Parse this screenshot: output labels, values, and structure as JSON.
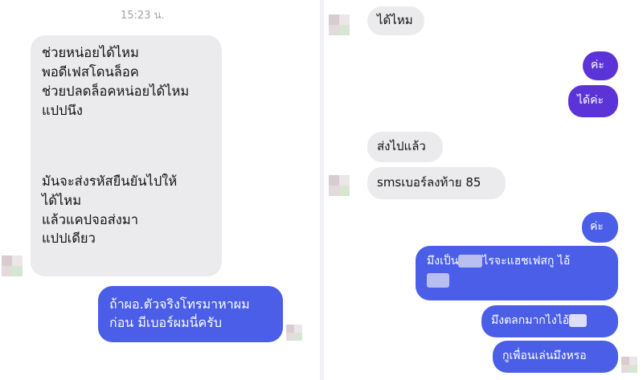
{
  "left": {
    "timestamp": "15:23 น.",
    "incoming_block_1": [
      "ช่วยหน่อยได้ไหม",
      "พอดีเฟสโดนล็อค",
      "ช่วยปลดล็อคหน่อยได้ไหม",
      "แปปนึง"
    ],
    "incoming_block_2": [
      "มันจะส่งรหัสยืนยันไปให้",
      "ได้ไหม",
      "แล้วแคปจอส่งมา",
      "แปปเดียว"
    ],
    "outgoing": [
      "ถ้าผอ.ตัวจริงโทรมาหาผม",
      "ก่อน มีเบอร์ผมนี่ครับ"
    ]
  },
  "right": {
    "incoming_1": "ได้ไหม",
    "outgoing_1": "ค่ะ",
    "outgoing_2": "ได้ค่ะ",
    "incoming_2": "ส่งไปแล้ว",
    "incoming_3": "smsเบอร์ลงท้าย 85",
    "outgoing_3": "ค่ะ",
    "outgoing_4_part1": "มึงเป็น",
    "outgoing_4_part2": "ไรจะแฮชเฟสกู  ไอ้",
    "outgoing_5": "มึงตลกมากไงไอ้",
    "outgoing_6": "กูเพื่อนเล่นมึงหรอ"
  },
  "colors": {
    "incoming_bubble": "#ebebee",
    "outgoing_bubble": "#4a5ee8",
    "outgoing_bubble_purple": "#5b33d6",
    "timestamp": "#a3a3a8"
  },
  "icons": [
    "avatar-icon"
  ]
}
